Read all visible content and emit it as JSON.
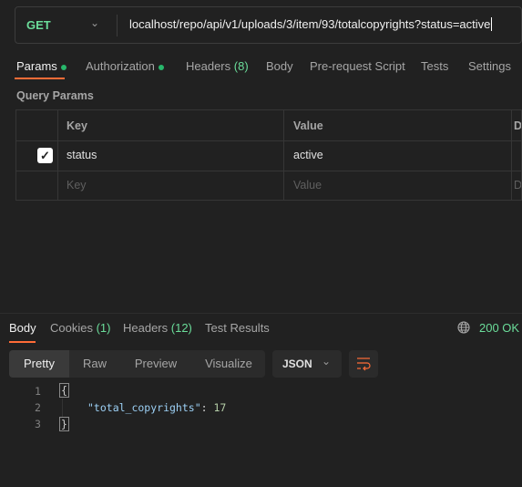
{
  "request": {
    "method": "GET",
    "url": "localhost/repo/api/v1/uploads/3/item/93/totalcopyrights?status=active"
  },
  "tabs": [
    {
      "label": "Params",
      "dot": true
    },
    {
      "label": "Authorization",
      "dot": true
    },
    {
      "label": "Headers",
      "count": "(8)"
    },
    {
      "label": "Body"
    },
    {
      "label": "Pre-request Script"
    },
    {
      "label": "Tests"
    },
    {
      "label": "Settings"
    }
  ],
  "query_params": {
    "title": "Query Params",
    "headers": [
      "Key",
      "Value",
      "Description"
    ],
    "rows": [
      {
        "checked": true,
        "key": "status",
        "value": "active"
      }
    ],
    "placeholder": {
      "key": "Key",
      "value": "Value",
      "description": "Description"
    }
  },
  "response": {
    "tabs": [
      {
        "label": "Body"
      },
      {
        "label": "Cookies",
        "count": "(1)"
      },
      {
        "label": "Headers",
        "count": "(12)"
      },
      {
        "label": "Test Results"
      }
    ],
    "status": "200 OK",
    "views": [
      "Pretty",
      "Raw",
      "Preview",
      "Visualize"
    ],
    "selected_view": "Pretty",
    "format": "JSON",
    "lines": [
      "1",
      "2",
      "3"
    ],
    "body": {
      "open": "{",
      "key": "\"total_copyrights\"",
      "colon": ": ",
      "value": "17",
      "close": "}"
    }
  },
  "colors": {
    "accent": "#ff6c37",
    "success": "#6bdd9a"
  },
  "icons": {
    "method_dropdown": "chevron-down-icon",
    "status": "globe-icon",
    "wrap": "wrap-lines-icon"
  }
}
